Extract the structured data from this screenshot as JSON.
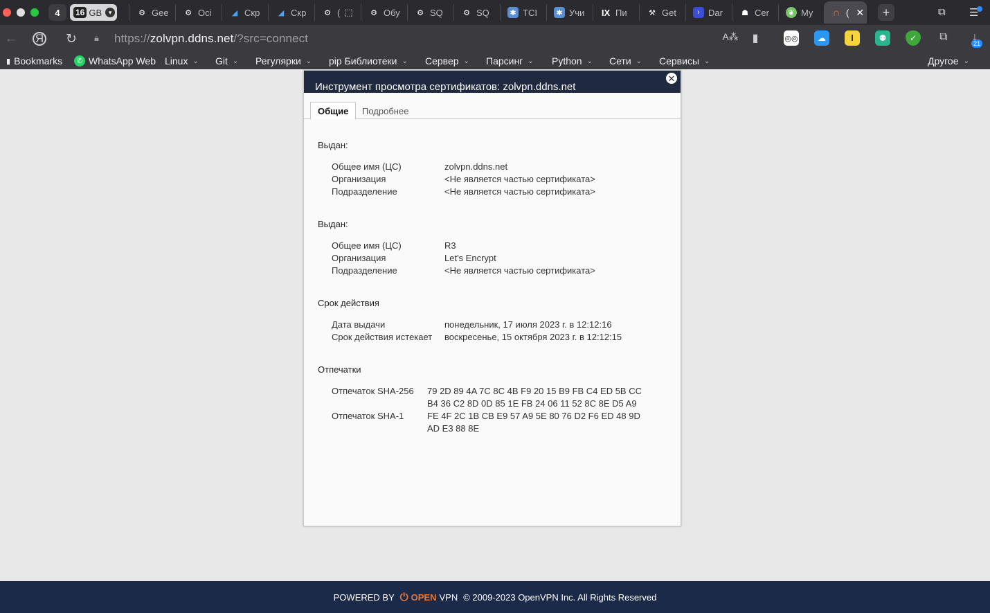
{
  "browser": {
    "tab_count": "4",
    "memory": {
      "value": "16",
      "unit": "GB"
    },
    "tabs": [
      {
        "label": "Gee",
        "icon": "openai-icon"
      },
      {
        "label": "Oci",
        "icon": "openai-icon"
      },
      {
        "label": "Скр",
        "icon": "stripe-icon"
      },
      {
        "label": "Скр",
        "icon": "stripe-icon"
      },
      {
        "label": "(",
        "icon": "openai-icon"
      },
      {
        "label": "Обу",
        "icon": "openai-icon"
      },
      {
        "label": "SQ",
        "icon": "openai-icon"
      },
      {
        "label": "SQ",
        "icon": "openai-icon"
      },
      {
        "label": "TCI",
        "icon": "app-icon"
      },
      {
        "label": "Учи",
        "icon": "app-icon"
      },
      {
        "label": "Пи",
        "icon": "ix-icon"
      },
      {
        "label": "Get",
        "icon": "tool-icon"
      },
      {
        "label": "Dar",
        "icon": "arrow-icon"
      },
      {
        "label": "Cer",
        "icon": "person-icon"
      },
      {
        "label": "My",
        "icon": "leaf-icon"
      }
    ],
    "active_tab": {
      "label": "(",
      "icon": "openvpn-icon"
    },
    "url_prefix": "https://",
    "url_host": "zolvpn.ddns.net",
    "url_rest": "/?src=connect",
    "extension_badge": "21",
    "bookmarks": [
      {
        "label": "Bookmarks"
      },
      {
        "label": "WhatsApp Web"
      },
      {
        "label": "Linux"
      },
      {
        "label": "Git"
      },
      {
        "label": "Регулярки"
      },
      {
        "label": "pip Библиотеки"
      },
      {
        "label": "Сервер"
      },
      {
        "label": "Парсинг"
      },
      {
        "label": "Python"
      },
      {
        "label": "Сети"
      },
      {
        "label": "Сервисы"
      },
      {
        "label": "Другое"
      }
    ]
  },
  "dialog": {
    "title": "Инструмент просмотра сертификатов: zolvpn.ddns.net",
    "tabs": {
      "general": "Общие",
      "details": "Подробнее"
    },
    "issued_to": {
      "heading": "Выдан:",
      "cn_label": "Общее имя (ЦС)",
      "cn": "zolvpn.ddns.net",
      "org_label": "Организация",
      "org": "<Не является частью сертификата>",
      "ou_label": "Подразделение",
      "ou": "<Не является частью сертификата>"
    },
    "issued_by": {
      "heading": "Выдан:",
      "cn_label": "Общее имя (ЦС)",
      "cn": "R3",
      "org_label": "Организация",
      "org": "Let's Encrypt",
      "ou_label": "Подразделение",
      "ou": "<Не является частью сертификата>"
    },
    "validity": {
      "heading": "Срок действия",
      "issued_label": "Дата выдачи",
      "issued": "понедельник, 17 июля 2023 г. в 12:12:16",
      "expires_label": "Срок действия истекает",
      "expires": "воскресенье, 15 октября 2023 г. в 12:12:15"
    },
    "fingerprints": {
      "heading": "Отпечатки",
      "sha256_label": "Отпечаток SHA-256",
      "sha256_line1": "79 2D 89 4A 7C 8C 4B F9 20 15 B9 FB C4 ED 5B CC",
      "sha256_line2": "B4 36 C2 8D 0D 85 1E FB 24 06 11 52 8C 8E D5 A9",
      "sha1_label": "Отпечаток SHA-1",
      "sha1_line1": "FE 4F 2C 1B CB E9 57 A9 5E 80 76 D2 F6 ED 48 9D",
      "sha1_line2": "AD E3 88 8E"
    }
  },
  "footer": {
    "powered_by": "POWERED BY",
    "brand_open": "OPEN",
    "brand_vpn": "VPN",
    "copyright": "© 2009-2023 OpenVPN Inc. All Rights Reserved"
  }
}
